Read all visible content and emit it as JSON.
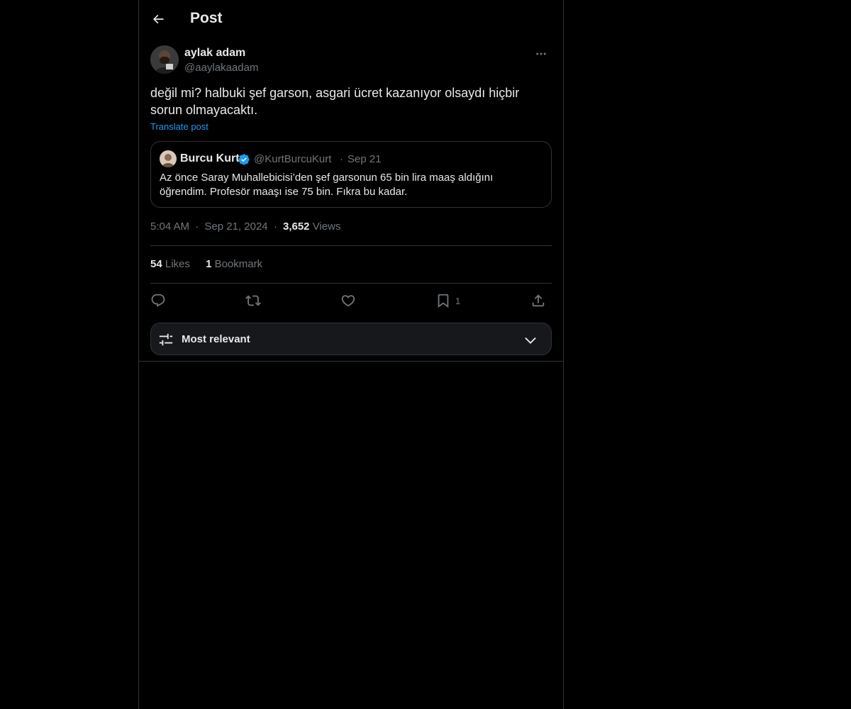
{
  "header": {
    "title": "Post",
    "back_icon": "arrow-left-icon"
  },
  "post": {
    "author_name": "aylak adam",
    "author_handle": "@aaylakaadam",
    "text": "değil mi? halbuki şef garson, asgari ücret kazanıyor olsaydı hiçbir sorun olmayacaktı.",
    "translate_label": "Translate post",
    "time": "5:04 AM",
    "date": "Sep 21, 2024",
    "separator": "·",
    "views_count": "3,652",
    "views_label": "Views"
  },
  "quote": {
    "author_name": "Burcu Kurt",
    "verified": true,
    "author_handle": "@KurtBurcuKurt",
    "separator": "·",
    "date": "Sep 21",
    "text": "Az önce Saray Muhallebicisi’den şef garsonun 65 bin lira maaş aldığını öğrendim. Profesör maaşı ise 75 bin. Fıkra bu kadar."
  },
  "stats": {
    "likes_count": "54",
    "likes_label": "Likes",
    "bookmarks_count": "1",
    "bookmarks_label": "Bookmark"
  },
  "actions": {
    "reply_icon": "reply-icon",
    "repost_icon": "repost-icon",
    "like_icon": "heart-icon",
    "bookmark_icon": "bookmark-icon",
    "bookmark_count": "1",
    "share_icon": "share-icon"
  },
  "sort": {
    "label": "Most relevant",
    "icon": "sliders-icon"
  },
  "colors": {
    "background": "#000000",
    "text": "#e7e9ea",
    "muted": "#71767b",
    "accent": "#1d9bf0",
    "border": "#2f3336"
  }
}
